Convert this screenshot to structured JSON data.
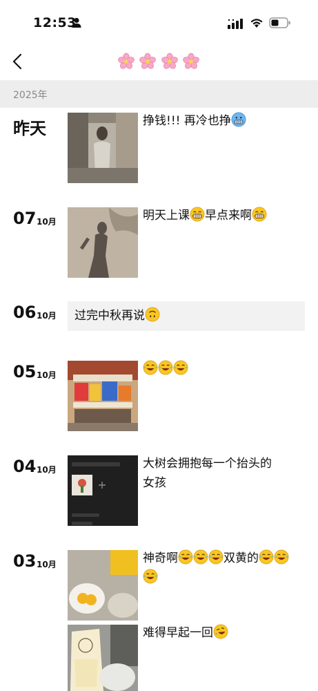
{
  "status": {
    "time": "12:53"
  },
  "header": {
    "back_icon": "chevron-left-icon",
    "title_icons": [
      "cherry-blossom",
      "cherry-blossom",
      "cherry-blossom",
      "cherry-blossom"
    ]
  },
  "year": "2025年",
  "posts": [
    {
      "day": "昨天",
      "month": "",
      "text": "挣钱!!! 再冷也挣",
      "emoji_after": [
        "cold-face"
      ],
      "image": "photo-mirror-selfie"
    },
    {
      "day": "07",
      "month": "10月",
      "text_parts": [
        "明天上课",
        "早点来啊"
      ],
      "image": "photo-shadow-silhouette"
    },
    {
      "day": "06",
      "month": "10月",
      "text": "过完中秋再说",
      "emoji_after": [
        "upside-down-face"
      ]
    },
    {
      "day": "05",
      "month": "10月",
      "text": "",
      "emoji_after": [
        "tears-of-joy",
        "tears-of-joy",
        "tears-of-joy"
      ],
      "image": "photo-snack-cart"
    },
    {
      "day": "04",
      "month": "10月",
      "text_lines": [
        "大树会拥抱每一个抬头的",
        "女孩"
      ],
      "image": "screenshot-dark-app"
    },
    {
      "day": "03",
      "month": "10月",
      "text_a": "神奇啊",
      "text_b": "双黄的",
      "text_c": "难得早起一回",
      "images": [
        "photo-double-yolk-egg",
        "photo-breakfast-bag"
      ]
    }
  ],
  "colors": {
    "year_bar": "#ededed",
    "text_bubble": "#f2f2f2",
    "emoji_yellow": "#f9c623"
  }
}
